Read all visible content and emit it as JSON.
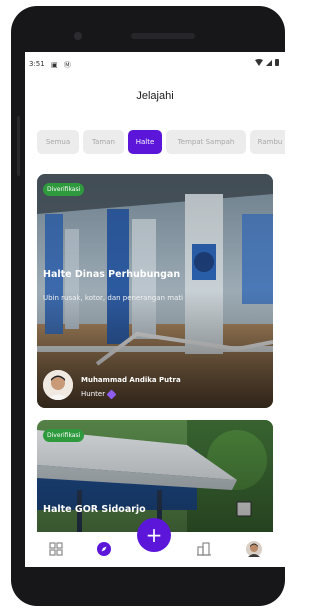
{
  "status_bar": {
    "time": "3:51",
    "left_icons": "▣ Ⓜ"
  },
  "header": {
    "title": "Jelajahi"
  },
  "filters": [
    "Semua",
    "Taman",
    "Halte",
    "Tempat Sampah",
    "Rambu"
  ],
  "active_filter": "Halte",
  "cards": [
    {
      "badge": "Diverifikasi",
      "title": "Halte Dinas Perhubungan",
      "description": "Ubin rusak, kotor, dan penerangan mati",
      "user": "Muhammad Andika Putra",
      "role": "Hunter"
    },
    {
      "badge": "Diverifikasi",
      "title": "Halte GOR Sidoarjo"
    }
  ],
  "nav": {
    "fab_label": "+",
    "icons": [
      "grid-icon",
      "compass-icon",
      "add-icon",
      "buildings-icon",
      "profile-avatar"
    ]
  },
  "colors": {
    "accent": "#5b16d9",
    "verified": "#2e9a3d"
  }
}
